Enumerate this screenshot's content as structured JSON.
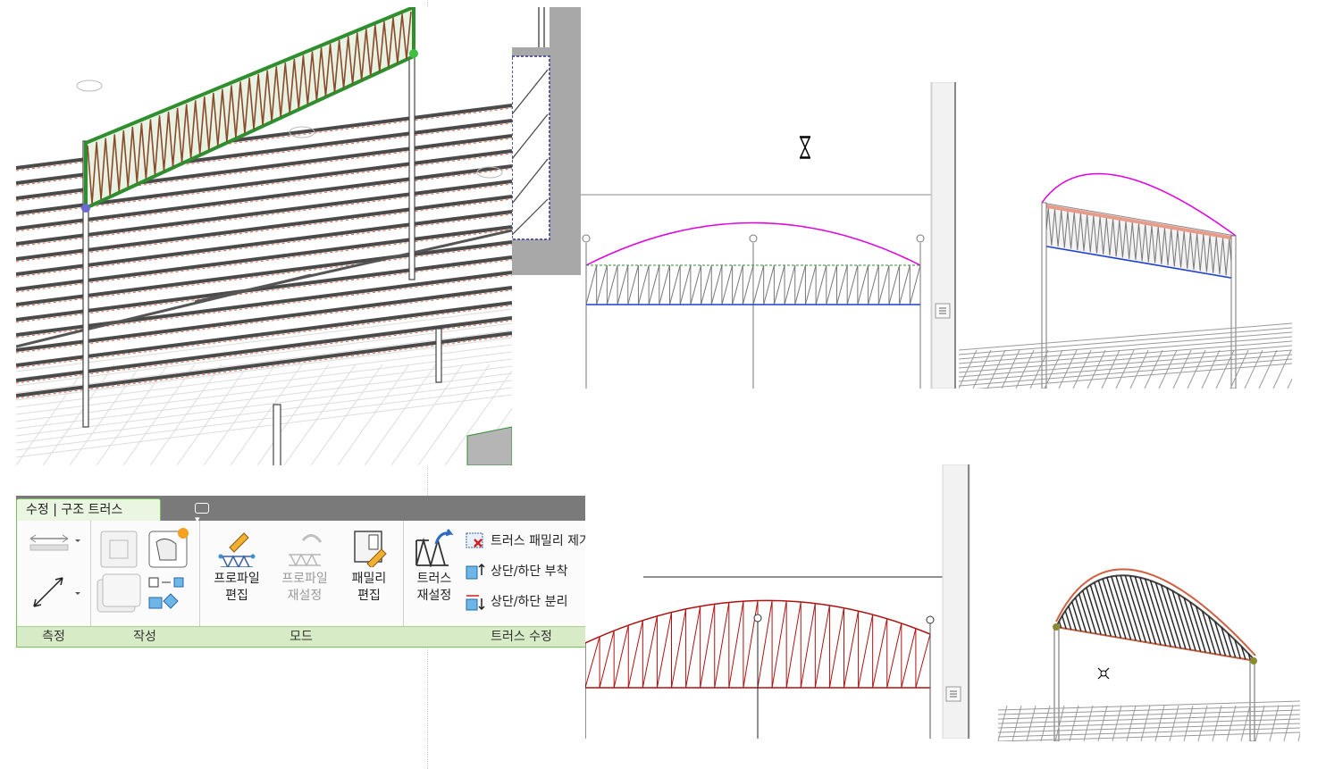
{
  "ribbon": {
    "context_tab": "수정 | 구조 트러스",
    "groups": {
      "measure": "측정",
      "create": "작성",
      "mode": "모드",
      "truss_modify": "트러스 수정"
    },
    "buttons": {
      "edit_profile": [
        "프로파일",
        "편집"
      ],
      "reset_profile": [
        "프로파일",
        "재설정"
      ],
      "edit_family": [
        "패밀리",
        "편집"
      ],
      "reset_truss": [
        "트러스",
        "재설정"
      ],
      "remove_truss_family": "트러스 패밀리 제거",
      "attach_top_bottom": "상단/하단 부착",
      "detach_top_bottom": "상단/하단 분리"
    }
  },
  "icons": [
    "hourglass-icon",
    "scroll-grip-icon",
    "cursor-target-icon"
  ],
  "colors": {
    "ribbon_accent": "#7cbf5a",
    "profile_curve": "#e000e0",
    "bottom_chord": "#1f3fd0",
    "truss_web_edit": "#b01010",
    "selection_green": "#2f8f2f"
  }
}
